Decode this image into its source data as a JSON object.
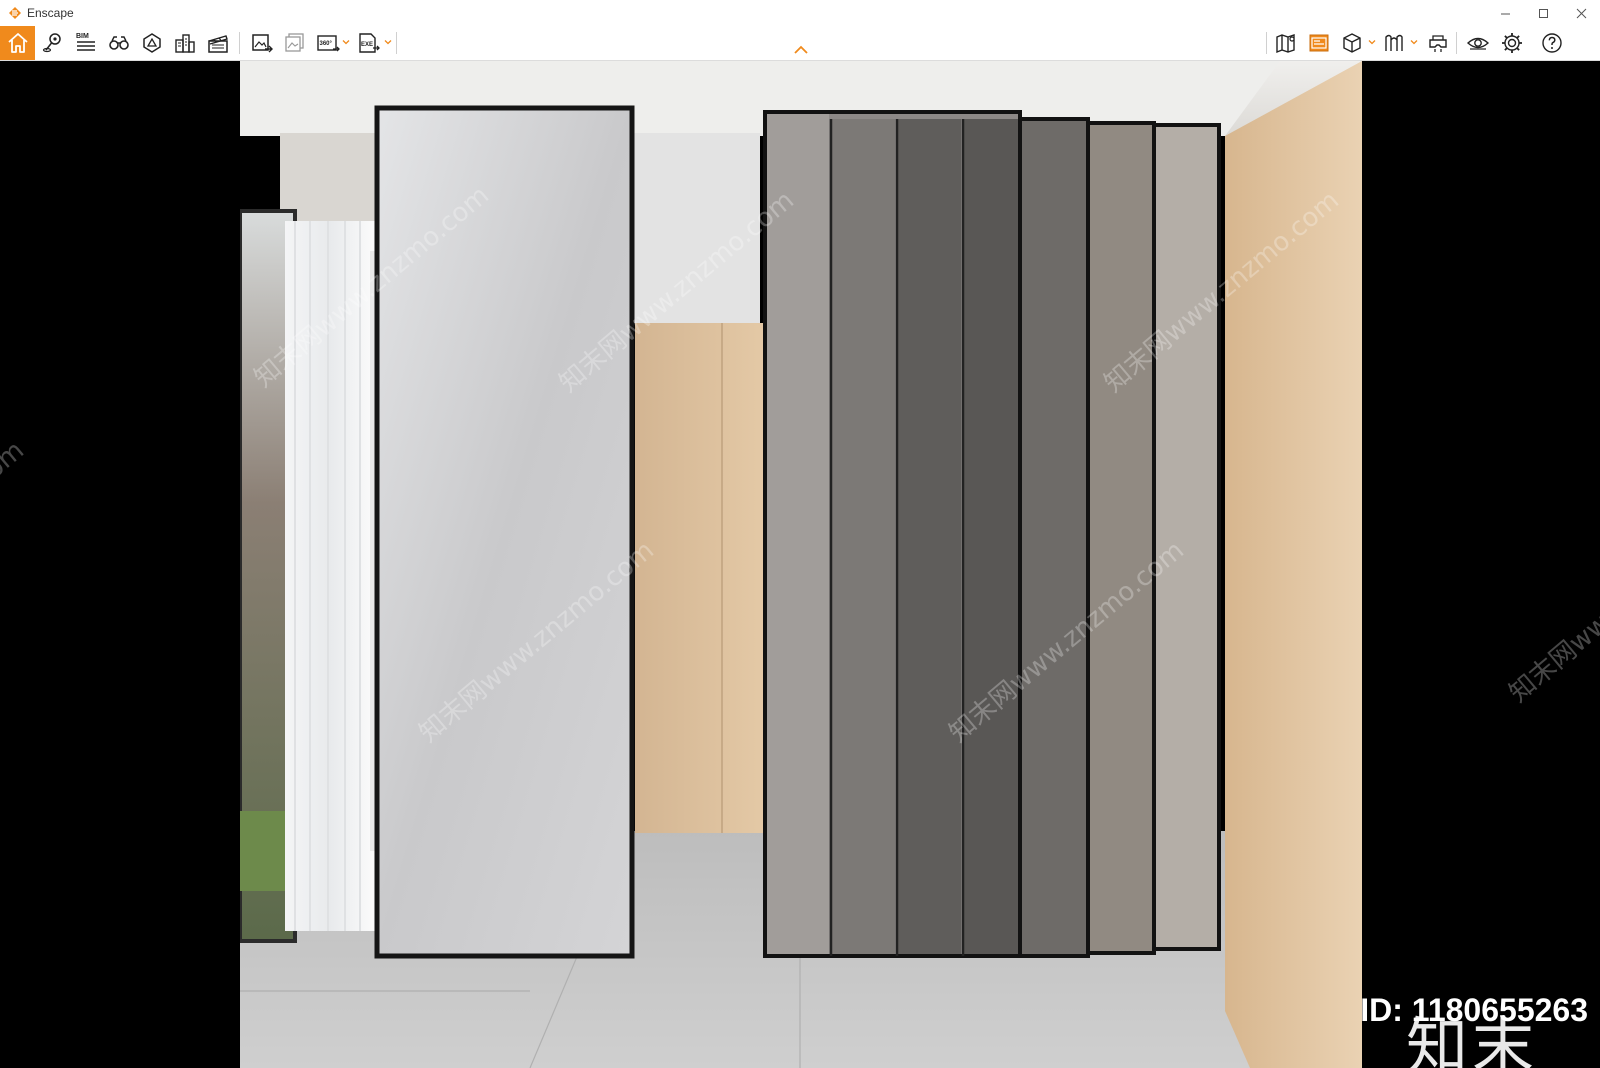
{
  "window": {
    "title": "Enscape",
    "accent": "#f08a1c"
  },
  "toolbar": {
    "left_items": [
      {
        "name": "home",
        "icon": "home-icon"
      },
      {
        "name": "set-location",
        "icon": "location-pin-icon"
      },
      {
        "name": "bim",
        "icon": "bim-icon",
        "label": "BIM"
      },
      {
        "name": "views",
        "icon": "binoculars-icon"
      },
      {
        "name": "asset-library",
        "icon": "asset-library-icon"
      },
      {
        "name": "site-context",
        "icon": "buildings-icon"
      },
      {
        "name": "video-editor",
        "icon": "clapperboard-icon"
      },
      {
        "name": "render-image",
        "icon": "render-image-icon"
      },
      {
        "name": "batch-render",
        "icon": "batch-render-icon"
      },
      {
        "name": "panorama",
        "icon": "panorama-360-icon",
        "label": "360°"
      },
      {
        "name": "export",
        "icon": "export-exe-icon",
        "label": "EXE"
      }
    ],
    "right_items": [
      {
        "name": "map",
        "icon": "map-icon"
      },
      {
        "name": "atmosphere",
        "icon": "atmosphere-panel-icon"
      },
      {
        "name": "cube",
        "icon": "cube-icon"
      },
      {
        "name": "mode",
        "icon": "mode-icon"
      },
      {
        "name": "vr",
        "icon": "vr-headset-icon"
      },
      {
        "name": "visual-settings",
        "icon": "eye-icon"
      },
      {
        "name": "settings",
        "icon": "gear-icon"
      },
      {
        "name": "help",
        "icon": "help-icon"
      }
    ]
  },
  "watermark": {
    "text": "知末网www.znzmo.com",
    "brand": "知末",
    "id_text": "ID: 1180655263"
  }
}
